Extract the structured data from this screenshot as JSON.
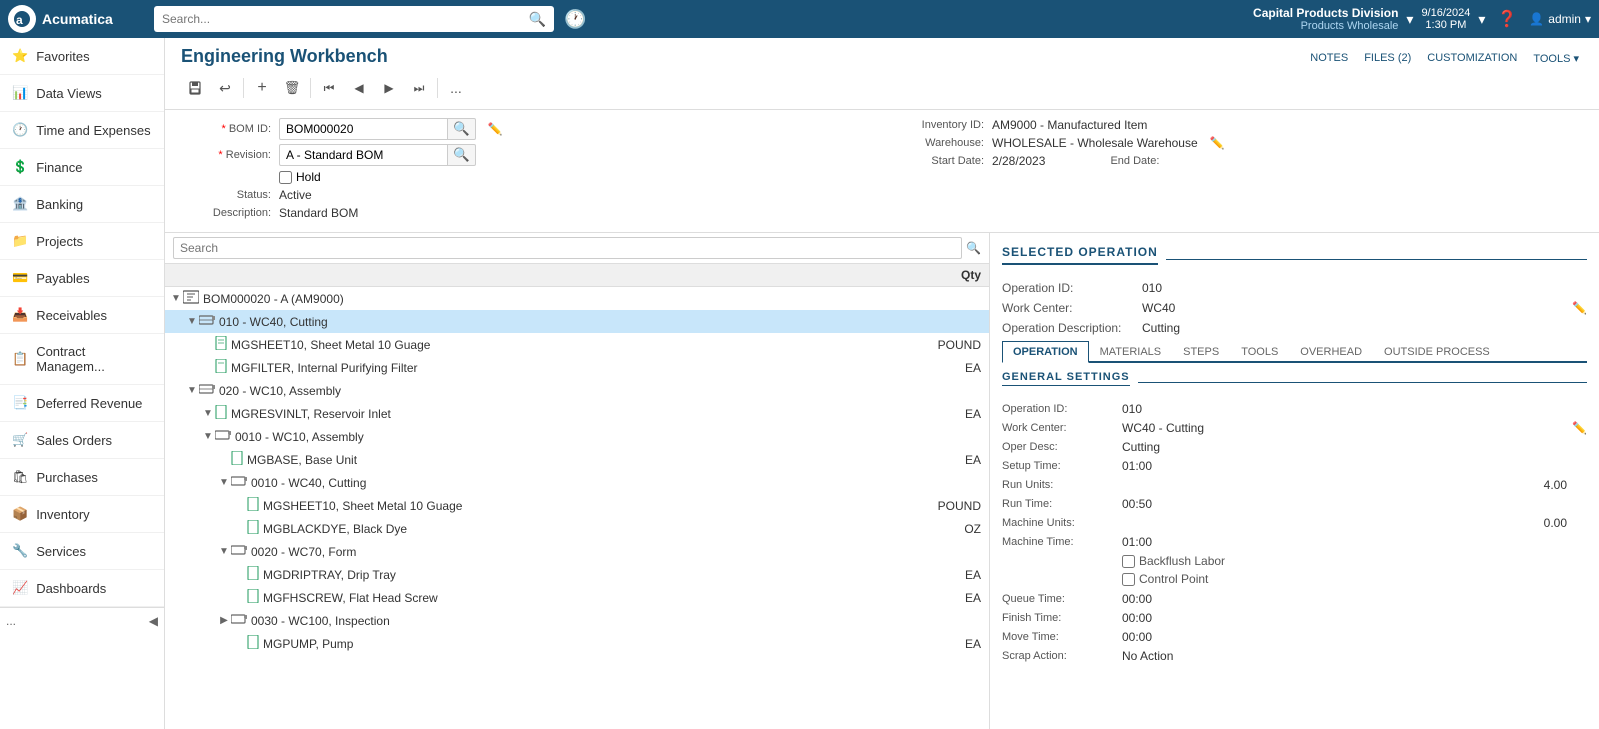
{
  "topNav": {
    "logoText": "Acumatica",
    "searchPlaceholder": "Search...",
    "company": "Capital Products Division",
    "companySubtitle": "Products Wholesale",
    "date": "9/16/2024",
    "time": "1:30 PM",
    "helpLabel": "?",
    "userLabel": "admin"
  },
  "sidebar": {
    "items": [
      {
        "id": "favorites",
        "label": "Favorites",
        "icon": "star"
      },
      {
        "id": "data-views",
        "label": "Data Views",
        "icon": "chart"
      },
      {
        "id": "time-expenses",
        "label": "Time and Expenses",
        "icon": "clock"
      },
      {
        "id": "finance",
        "label": "Finance",
        "icon": "dollar"
      },
      {
        "id": "banking",
        "label": "Banking",
        "icon": "bank"
      },
      {
        "id": "projects",
        "label": "Projects",
        "icon": "folder"
      },
      {
        "id": "payables",
        "label": "Payables",
        "icon": "payable"
      },
      {
        "id": "receivables",
        "label": "Receivables",
        "icon": "receive"
      },
      {
        "id": "contract-mgmt",
        "label": "Contract Managem...",
        "icon": "contract"
      },
      {
        "id": "deferred-revenue",
        "label": "Deferred Revenue",
        "icon": "deferred"
      },
      {
        "id": "sales-orders",
        "label": "Sales Orders",
        "icon": "sales"
      },
      {
        "id": "purchases",
        "label": "Purchases",
        "icon": "purchase"
      },
      {
        "id": "inventory",
        "label": "Inventory",
        "icon": "inventory"
      },
      {
        "id": "services",
        "label": "Services",
        "icon": "services"
      },
      {
        "id": "dashboards",
        "label": "Dashboards",
        "icon": "dashboard"
      }
    ],
    "moreLabel": "..."
  },
  "page": {
    "title": "Engineering Workbench",
    "toolbar": {
      "save": "💾",
      "undo": "↩",
      "add": "+",
      "delete": "🗑",
      "first": "⏮",
      "prev": "◀",
      "next": "▶",
      "last": "⏭",
      "more": "..."
    },
    "topActions": {
      "notes": "NOTES",
      "files": "FILES (2)",
      "customization": "CUSTOMIZATION",
      "tools": "TOOLS ▾"
    }
  },
  "form": {
    "bomIdLabel": "BOM ID:",
    "bomIdValue": "BOM000020",
    "revisionLabel": "Revision:",
    "revisionValue": "A - Standard BOM",
    "holdLabel": "Hold",
    "holdChecked": false,
    "statusLabel": "Status:",
    "statusValue": "Active",
    "descriptionLabel": "Description:",
    "descriptionValue": "Standard BOM",
    "inventoryIdLabel": "Inventory ID:",
    "inventoryIdValue": "AM9000 - Manufactured Item",
    "warehouseLabel": "Warehouse:",
    "warehouseValue": "WHOLESALE - Wholesale Warehouse",
    "startDateLabel": "Start Date:",
    "startDateValue": "2/28/2023",
    "endDateLabel": "End Date:",
    "endDateValue": ""
  },
  "tree": {
    "searchPlaceholder": "Search",
    "qtyHeader": "Qty",
    "items": [
      {
        "id": "bom-root",
        "level": 0,
        "type": "bom",
        "label": "BOM000020 - A (AM9000)",
        "qty": "",
        "expanded": true,
        "selected": false
      },
      {
        "id": "op-010",
        "level": 1,
        "type": "operation",
        "label": "010 - WC40, Cutting",
        "qty": "",
        "expanded": true,
        "selected": true
      },
      {
        "id": "mgsheet10-1",
        "level": 2,
        "type": "material",
        "label": "MGSHEET10, Sheet Metal 10 Guage",
        "qty": "POUND",
        "selected": false
      },
      {
        "id": "mgfilter",
        "level": 2,
        "type": "material",
        "label": "MGFILTER, Internal Purifying Filter",
        "qty": "EA",
        "selected": false
      },
      {
        "id": "op-020",
        "level": 1,
        "type": "operation",
        "label": "020 - WC10, Assembly",
        "qty": "",
        "expanded": true,
        "selected": false
      },
      {
        "id": "mgresvinlt",
        "level": 2,
        "type": "material",
        "label": "MGRESVINLT, Reservoir Inlet",
        "qty": "EA",
        "selected": false
      },
      {
        "id": "sub-op-0010",
        "level": 2,
        "type": "sub-operation",
        "label": "0010 - WC10, Assembly",
        "qty": "",
        "expanded": true,
        "selected": false
      },
      {
        "id": "mgbase",
        "level": 3,
        "type": "material",
        "label": "MGBASE, Base Unit",
        "qty": "EA",
        "selected": false
      },
      {
        "id": "sub-op-0010-cut",
        "level": 3,
        "type": "sub-operation",
        "label": "0010 - WC40, Cutting",
        "qty": "",
        "expanded": true,
        "selected": false
      },
      {
        "id": "mgsheet10-2",
        "level": 4,
        "type": "material",
        "label": "MGSHEET10, Sheet Metal 10 Guage",
        "qty": "POUND",
        "selected": false
      },
      {
        "id": "mgblackdye",
        "level": 4,
        "type": "material",
        "label": "MGBLACKDYE, Black Dye",
        "qty": "OZ",
        "selected": false
      },
      {
        "id": "sub-op-0020",
        "level": 3,
        "type": "sub-operation",
        "label": "0020 - WC70, Form",
        "qty": "",
        "expanded": true,
        "selected": false
      },
      {
        "id": "mgdriptray",
        "level": 4,
        "type": "material",
        "label": "MGDRIPTRAY, Drip Tray",
        "qty": "EA",
        "selected": false
      },
      {
        "id": "mgfhscrew",
        "level": 4,
        "type": "material",
        "label": "MGFHSCREW, Flat Head Screw",
        "qty": "EA",
        "selected": false
      },
      {
        "id": "op-0030",
        "level": 2,
        "type": "sub-operation",
        "label": "0030 - WC100, Inspection",
        "qty": "",
        "expanded": false,
        "selected": false
      },
      {
        "id": "mgpump",
        "level": 3,
        "type": "material",
        "label": "MGPUMP, Pump",
        "qty": "EA",
        "selected": false
      }
    ]
  },
  "selectedOperation": {
    "header": "SELECTED OPERATION",
    "operationIdLabel": "Operation ID:",
    "operationIdValue": "010",
    "workCenterLabel": "Work Center:",
    "workCenterValue": "WC40",
    "operationDescLabel": "Operation Description:",
    "operationDescValue": "Cutting",
    "tabs": [
      "OPERATION",
      "MATERIALS",
      "STEPS",
      "TOOLS",
      "OVERHEAD",
      "OUTSIDE PROCESS"
    ],
    "activeTab": "OPERATION",
    "generalSettings": {
      "header": "GENERAL SETTINGS",
      "fields": [
        {
          "label": "Operation ID:",
          "value": "010",
          "align": "left"
        },
        {
          "label": "Work Center:",
          "value": "WC40 - Cutting",
          "align": "left",
          "hasEdit": true
        },
        {
          "label": "Oper Desc:",
          "value": "Cutting",
          "align": "left"
        },
        {
          "label": "Setup Time:",
          "value": "01:00",
          "align": "left"
        },
        {
          "label": "Run Units:",
          "value": "4.00",
          "align": "right"
        },
        {
          "label": "Run Time:",
          "value": "00:50",
          "align": "left"
        },
        {
          "label": "Machine Units:",
          "value": "0.00",
          "align": "right"
        },
        {
          "label": "Machine Time:",
          "value": "01:00",
          "align": "left"
        }
      ],
      "checkboxes": [
        {
          "label": "Backflush Labor",
          "checked": false
        },
        {
          "label": "Control Point",
          "checked": false
        }
      ],
      "timeFields": [
        {
          "label": "Queue Time:",
          "value": "00:00"
        },
        {
          "label": "Finish Time:",
          "value": "00:00"
        },
        {
          "label": "Move Time:",
          "value": "00:00"
        },
        {
          "label": "Scrap Action:",
          "value": "No Action"
        }
      ]
    }
  }
}
